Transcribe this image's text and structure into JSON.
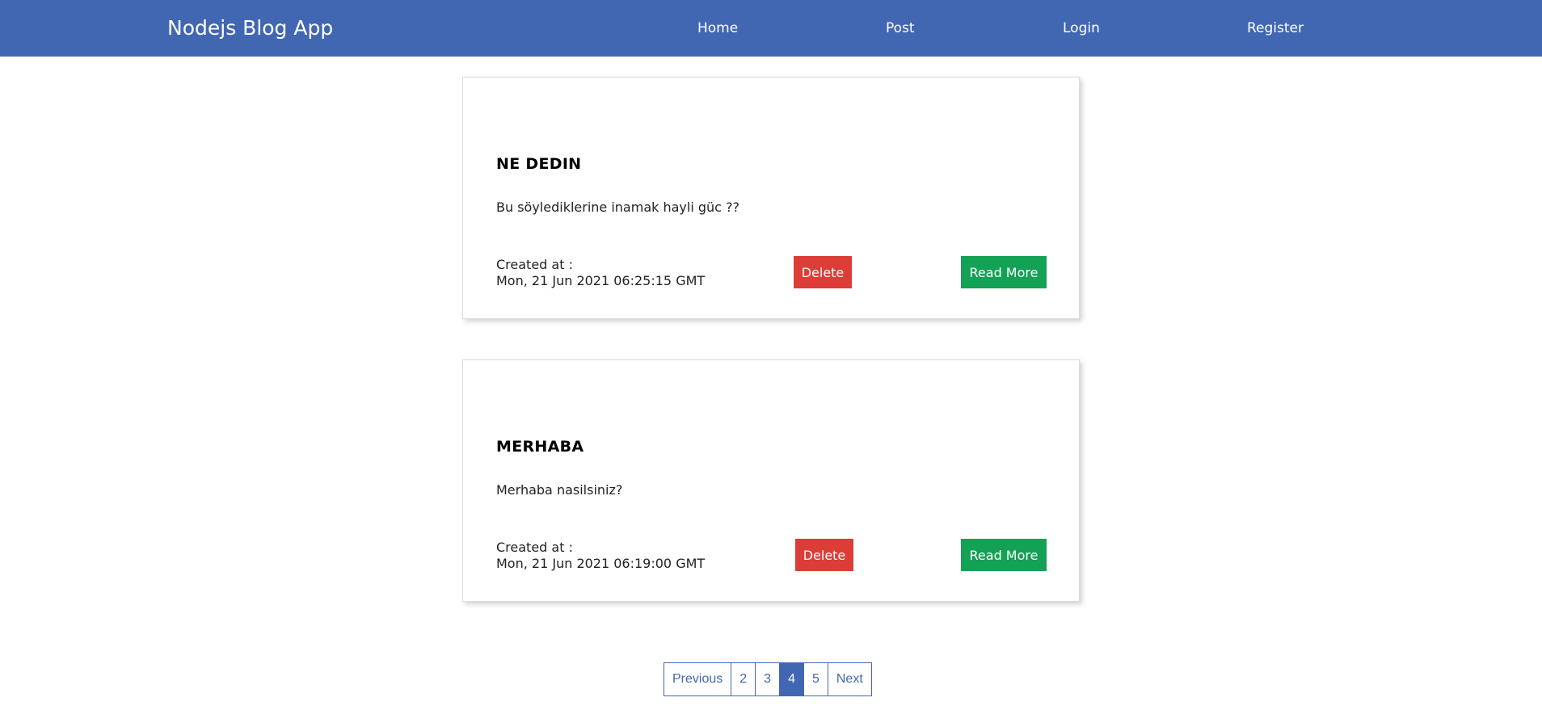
{
  "nav": {
    "brand": "Nodejs Blog App",
    "links": [
      "Home",
      "Post",
      "Login",
      "Register"
    ]
  },
  "posts": [
    {
      "title": "NE DEDIN",
      "body": "Bu söylediklerine inamak hayli güc ??",
      "created_label": "Created at :",
      "created_date": "Mon, 21 Jun 2021 06:25:15 GMT",
      "delete_label": "Delete",
      "read_more_label": "Read More"
    },
    {
      "title": "MERHABA",
      "body": "Merhaba nasilsiniz?",
      "created_label": "Created at :",
      "created_date": "Mon, 21 Jun 2021 06:19:00 GMT",
      "delete_label": "Delete",
      "read_more_label": "Read More"
    }
  ],
  "pagination": {
    "previous": "Previous",
    "pages": [
      "2",
      "3",
      "4",
      "5"
    ],
    "active_page": "4",
    "next": "Next"
  },
  "colors": {
    "navbar": "#4267b2",
    "delete": "#dc3d36",
    "read_more": "#13a155"
  }
}
